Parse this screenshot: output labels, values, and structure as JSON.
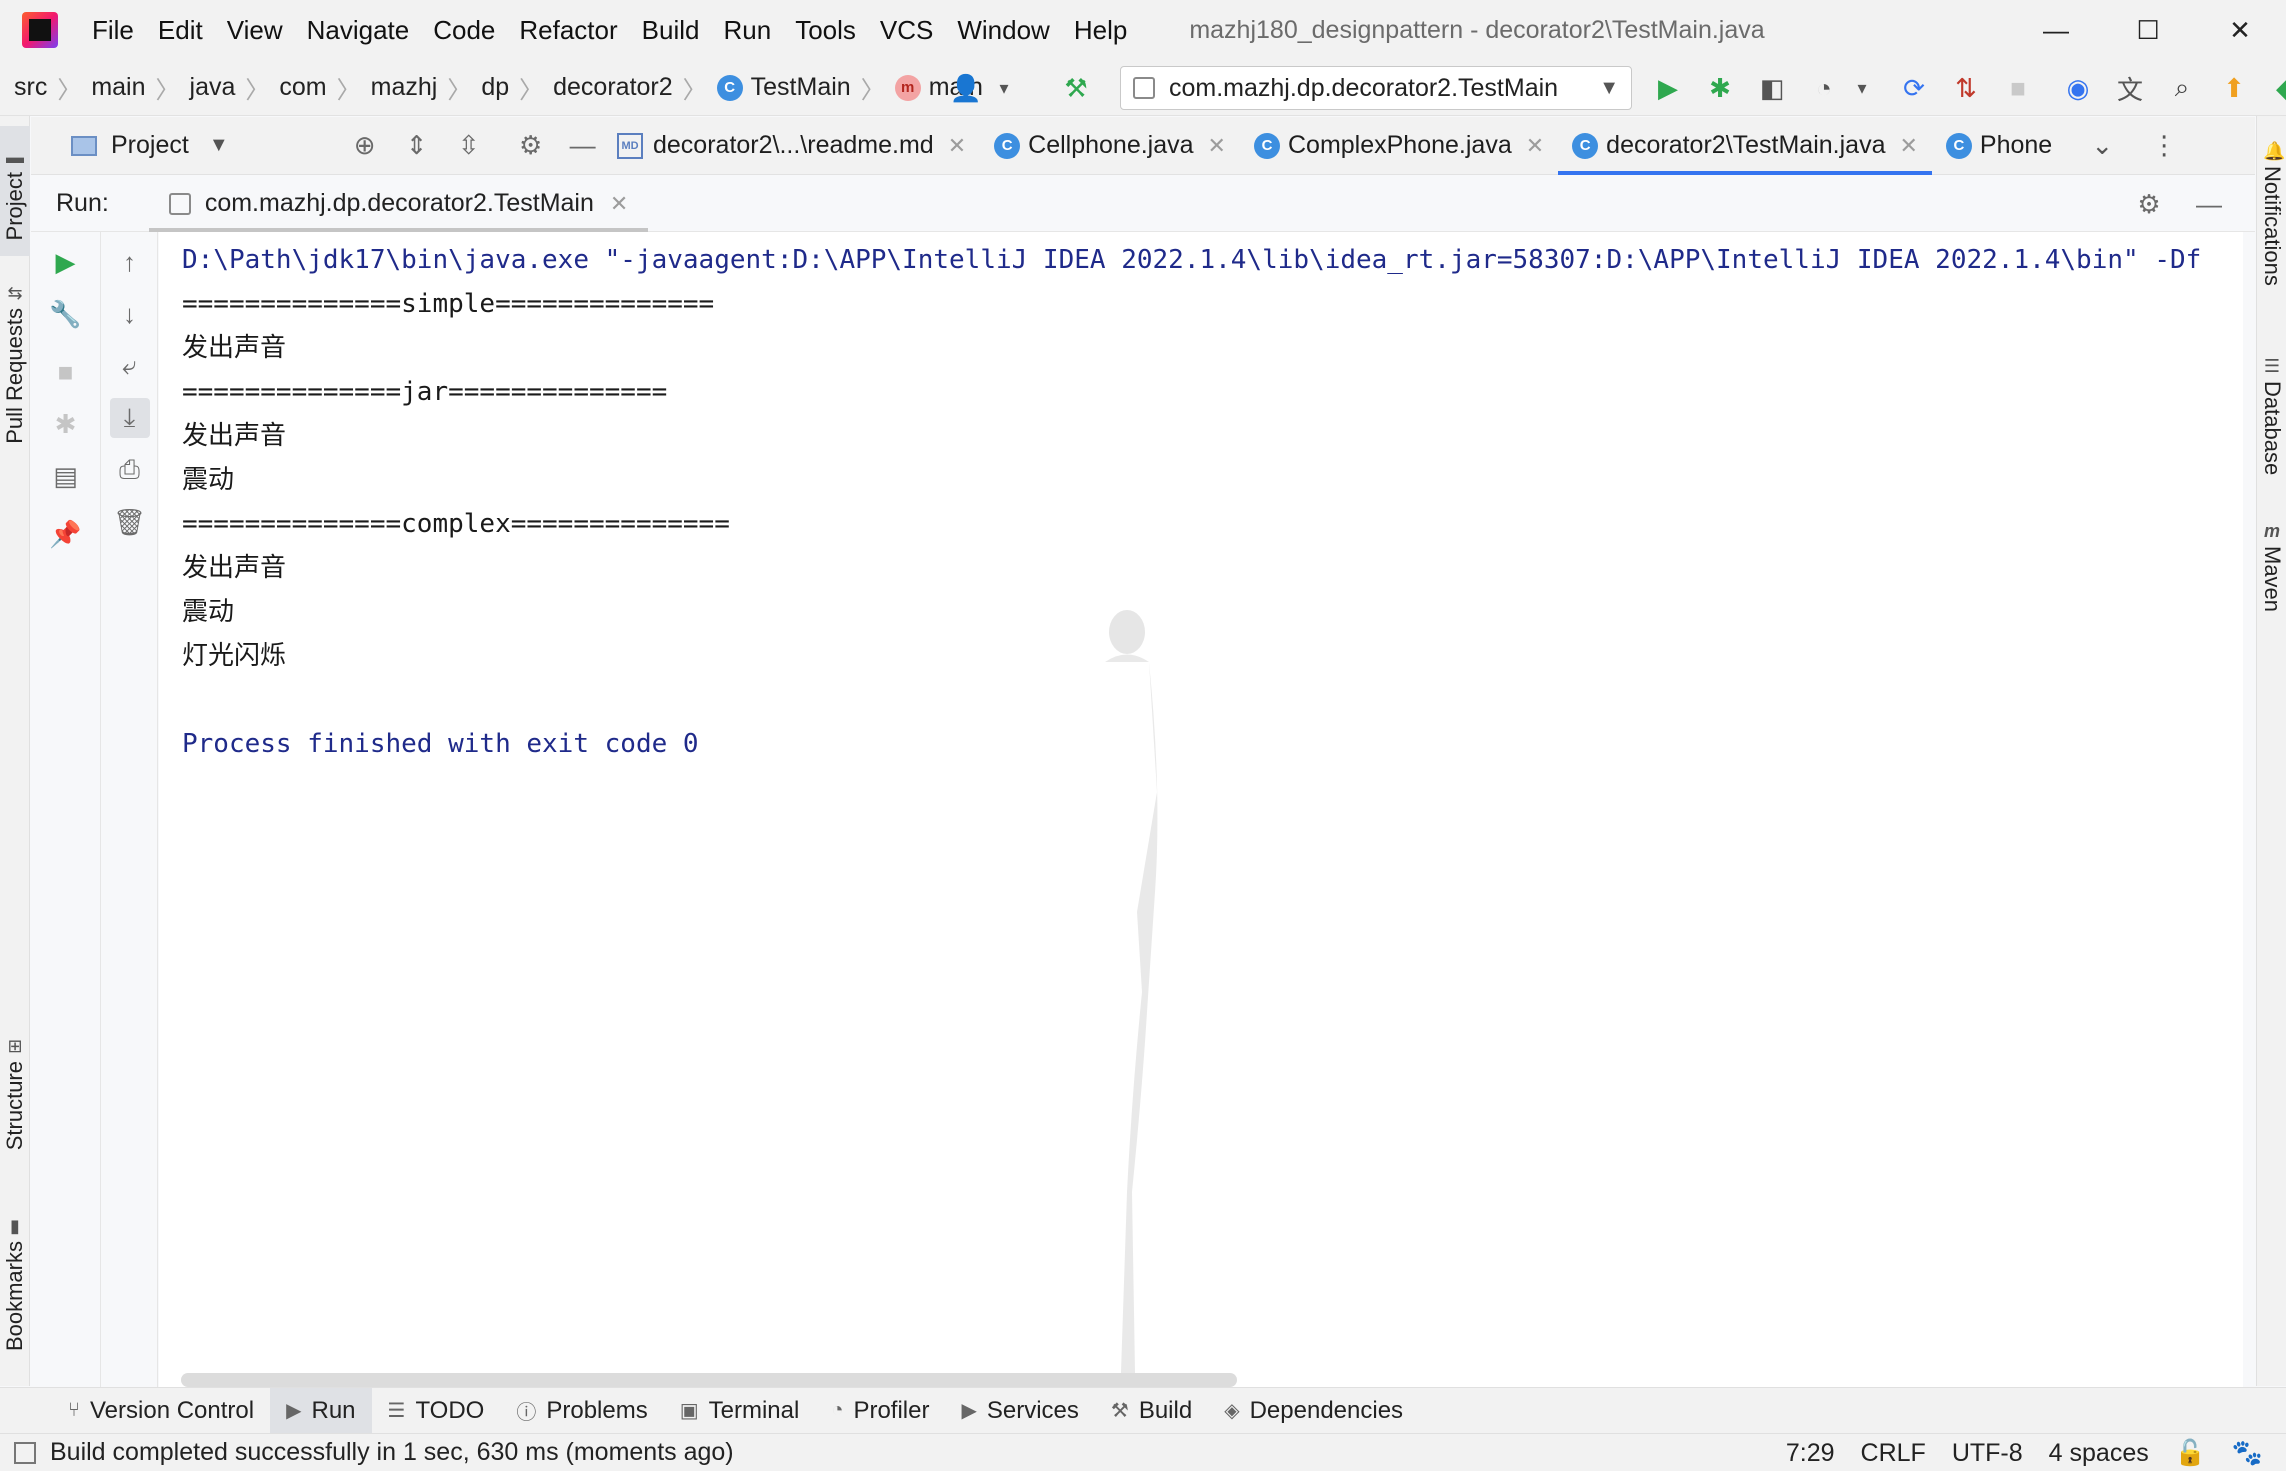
{
  "window": {
    "title": "mazhj180_designpattern - decorator2\\TestMain.java",
    "minimize": "—",
    "maximize": "☐",
    "close": "✕"
  },
  "menu": [
    "File",
    "Edit",
    "View",
    "Navigate",
    "Code",
    "Refactor",
    "Build",
    "Run",
    "Tools",
    "VCS",
    "Window",
    "Help"
  ],
  "breadcrumbs": [
    "src",
    "main",
    "java",
    "com",
    "mazhj",
    "dp",
    "decorator2",
    "TestMain",
    "main"
  ],
  "run_config": "com.mazhj.dp.decorator2.TestMain",
  "project_panel": {
    "label": "Project"
  },
  "editor_tabs": [
    {
      "label": "decorator2\\...\\readme.md",
      "icon": "markdown-icon"
    },
    {
      "label": "Cellphone.java",
      "icon": "class-icon"
    },
    {
      "label": "ComplexPhone.java",
      "icon": "class-icon"
    },
    {
      "label": "decorator2\\TestMain.java",
      "icon": "class-icon",
      "active": true
    },
    {
      "label": "Phone",
      "icon": "class-icon"
    }
  ],
  "run_window": {
    "label": "Run:",
    "tab_label": "com.mazhj.dp.decorator2.TestMain"
  },
  "console": {
    "command": "D:\\Path\\jdk17\\bin\\java.exe \"-javaagent:D:\\APP\\IntelliJ IDEA 2022.1.4\\lib\\idea_rt.jar=58307:D:\\APP\\IntelliJ IDEA 2022.1.4\\bin\" -Df",
    "lines": [
      "==============simple==============",
      "发出声音",
      "==============jar==============",
      "发出声音",
      "震动",
      "==============complex==============",
      "发出声音",
      "震动",
      "灯光闪烁",
      ""
    ],
    "exit": "Process finished with exit code 0"
  },
  "left_strip": {
    "project": "Project",
    "pull_requests": "Pull Requests",
    "structure": "Structure",
    "bookmarks": "Bookmarks"
  },
  "right_strip": {
    "notifications": "Notifications",
    "database": "Database",
    "maven": "Maven"
  },
  "bottom_tabs": [
    "Version Control",
    "Run",
    "TODO",
    "Problems",
    "Terminal",
    "Profiler",
    "Services",
    "Build",
    "Dependencies"
  ],
  "status": {
    "message": "Build completed successfully in 1 sec, 630 ms (moments ago)",
    "position": "7:29",
    "line_sep": "CRLF",
    "encoding": "UTF-8",
    "indent": "4 spaces"
  },
  "colors": {
    "accent": "#3574f0",
    "run_green": "#2fa84f",
    "console_text": "#1f2a8a"
  }
}
